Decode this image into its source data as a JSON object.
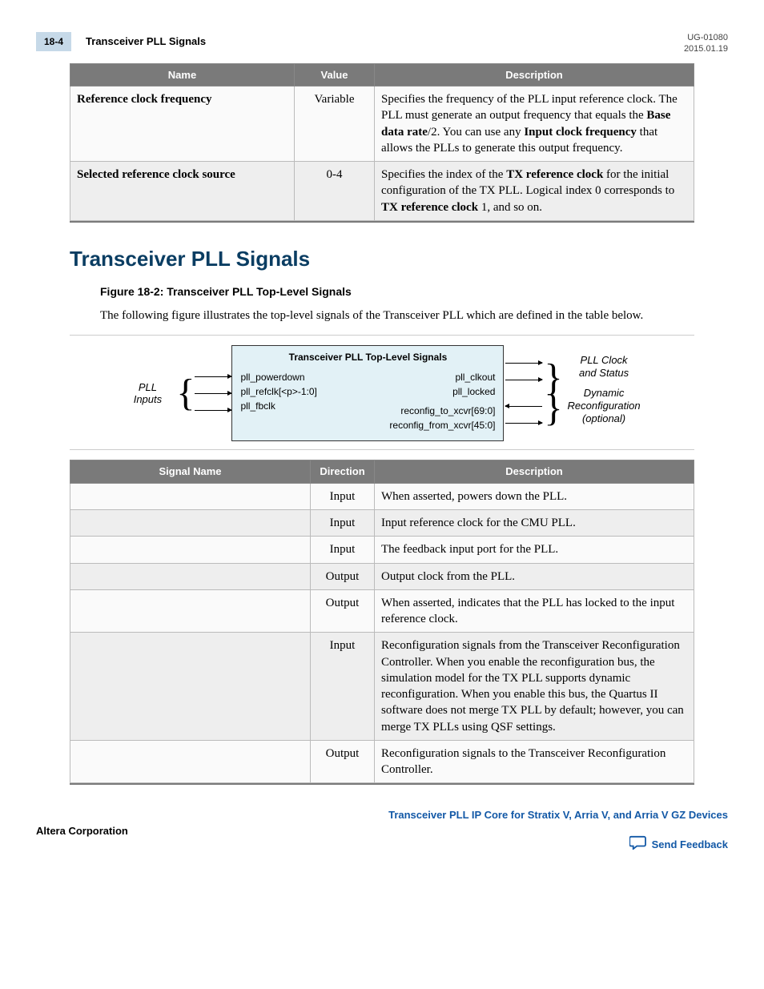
{
  "header": {
    "page_tab": "18-4",
    "breadcrumb": "Transceiver PLL Signals",
    "doc_id": "UG-01080",
    "doc_date": "2015.01.19"
  },
  "table1": {
    "headers": [
      "Name",
      "Value",
      "Description"
    ],
    "rows": [
      {
        "name": "Reference clock frequency",
        "value": "Variable",
        "desc_parts": [
          "Specifies the frequency of the PLL input reference clock. The PLL must generate an output frequency that equals the ",
          "Base data rate",
          "/2. You can use any ",
          "Input clock frequency",
          " that allows the PLLs to generate this output frequency."
        ]
      },
      {
        "name": "Selected reference clock source",
        "value": "0-4",
        "desc_parts": [
          "Specifies the index of the ",
          "TX reference clock",
          " for the initial configuration of the TX PLL. Logical index 0 corresponds to ",
          "TX reference clock",
          " 1, and so on."
        ]
      }
    ]
  },
  "section": {
    "title": "Transceiver PLL Signals",
    "figure_caption": "Figure 18-2: Transceiver PLL Top-Level Signals",
    "intro": "The following figure illustrates the top-level signals of the Transceiver PLL which are defined in the table below."
  },
  "diagram": {
    "block_title": "Transceiver PLL Top-Level Signals",
    "left_group_label": "PLL\nInputs",
    "left_ports": [
      "pll_powerdown",
      "pll_refclk[<p>-1:0]",
      "pll_fbclk"
    ],
    "right_ports_top": [
      "pll_clkout",
      "pll_locked"
    ],
    "right_ports_bottom": [
      "reconfig_to_xcvr[69:0]",
      "reconfig_from_xcvr[45:0]"
    ],
    "right_group_label_top": "PLL Clock\nand Status",
    "right_group_label_bottom": "Dynamic\nReconfiguration\n(optional)"
  },
  "table2": {
    "headers": [
      "Signal Name",
      "Direction",
      "Description"
    ],
    "rows": [
      {
        "name": "",
        "direction": "Input",
        "desc": "When asserted, powers down the PLL."
      },
      {
        "name": "",
        "direction": "Input",
        "desc": "Input reference clock for the CMU PLL."
      },
      {
        "name": "",
        "direction": "Input",
        "desc": "The feedback input port for the PLL."
      },
      {
        "name": "",
        "direction": "Output",
        "desc": "Output clock from the PLL."
      },
      {
        "name": "",
        "direction": "Output",
        "desc": "When asserted, indicates that the PLL has locked to the input reference clock."
      },
      {
        "name": "",
        "direction": "Input",
        "desc": "Reconfiguration signals from the Transceiver Reconfiguration Controller. When you enable the reconfiguration bus, the simulation model for the TX PLL supports dynamic reconfiguration. When you enable this bus, the Quartus II software does not merge TX PLL by default; however, you can merge TX PLLs using QSF settings."
      },
      {
        "name": "",
        "direction": "Output",
        "desc": "Reconfiguration signals to the Transceiver Reconfi­guration Controller."
      }
    ]
  },
  "footer": {
    "company": "Altera Corporation",
    "doc_title_link": "Transceiver PLL IP Core for Stratix V, Arria V, and Arria V GZ Devices",
    "feedback": "Send Feedback"
  }
}
